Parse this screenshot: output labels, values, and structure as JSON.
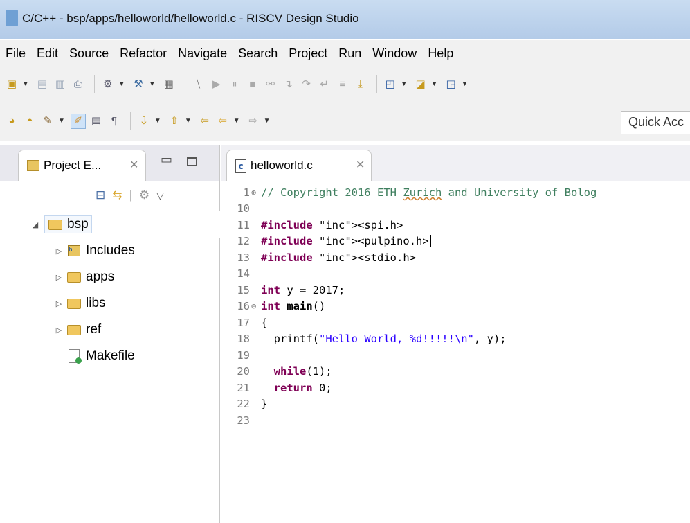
{
  "window": {
    "title": "C/C++ - bsp/apps/helloworld/helloworld.c - RISCV Design Studio"
  },
  "menu": [
    "File",
    "Edit",
    "Source",
    "Refactor",
    "Navigate",
    "Search",
    "Project",
    "Run",
    "Window",
    "Help"
  ],
  "quick_access": "Quick Acc",
  "project_explorer": {
    "tab_label": "Project E...",
    "tree": [
      {
        "label": "bsp",
        "expanded": true,
        "icon": "project-folder-icon"
      },
      {
        "label": "Includes",
        "icon": "includes-icon"
      },
      {
        "label": "apps",
        "icon": "folder-icon"
      },
      {
        "label": "libs",
        "icon": "folder-icon"
      },
      {
        "label": "ref",
        "icon": "folder-icon"
      },
      {
        "label": "Makefile",
        "icon": "makefile-icon"
      }
    ]
  },
  "editor": {
    "tab_label": "helloworld.c",
    "lines": [
      {
        "n": "1",
        "fold": "⊕",
        "code": "// Copyright 2016 ETH Zurich and University of Bolog"
      },
      {
        "n": "10",
        "fold": "",
        "code": ""
      },
      {
        "n": "11",
        "fold": "",
        "code": "#include <spi.h>"
      },
      {
        "n": "12",
        "fold": "",
        "code": "#include <pulpino.h>"
      },
      {
        "n": "13",
        "fold": "",
        "code": "#include <stdio.h>"
      },
      {
        "n": "14",
        "fold": "",
        "code": ""
      },
      {
        "n": "15",
        "fold": "",
        "code": "int y = 2017;"
      },
      {
        "n": "16",
        "fold": "⊖",
        "code": "int main()"
      },
      {
        "n": "17",
        "fold": "",
        "code": "{"
      },
      {
        "n": "18",
        "fold": "",
        "code": "  printf(\"Hello World, %d!!!!!\\n\", y);"
      },
      {
        "n": "19",
        "fold": "",
        "code": ""
      },
      {
        "n": "20",
        "fold": "",
        "code": "  while(1);"
      },
      {
        "n": "21",
        "fold": "",
        "code": "  return 0;"
      },
      {
        "n": "22",
        "fold": "",
        "code": "}"
      },
      {
        "n": "23",
        "fold": "",
        "code": ""
      }
    ]
  },
  "colors": {
    "keyword": "#7f0055",
    "string": "#2a00ff",
    "comment": "#3f7f5f",
    "titlebar": "#b3cbe8"
  }
}
